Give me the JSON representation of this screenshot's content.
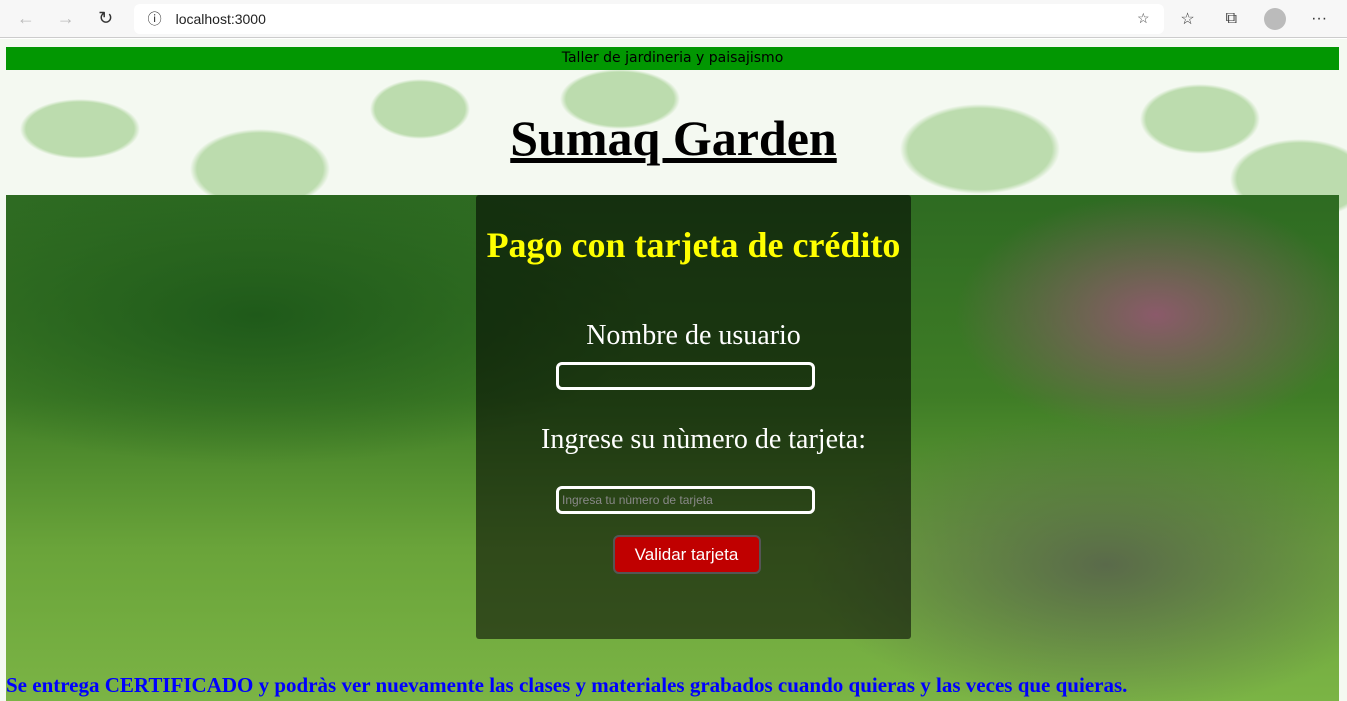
{
  "browser": {
    "url": "localhost:3000"
  },
  "topbar": {
    "text": "Taller de jardineria y paisajismo"
  },
  "header": {
    "title": "Sumaq Garden"
  },
  "form": {
    "title": "Pago con tarjeta de crédito",
    "username_label": "Nombre de usuario",
    "username_value": "",
    "card_label": "Ingrese su nùmero de tarjeta:",
    "card_placeholder": "Ingresa tu nùmero de tarjeta",
    "submit_label": "Validar tarjeta"
  },
  "footer": {
    "text": "Se entrega CERTIFICADO y podràs ver nuevamente las clases y materiales grabados cuando quieras y las veces que quieras."
  }
}
